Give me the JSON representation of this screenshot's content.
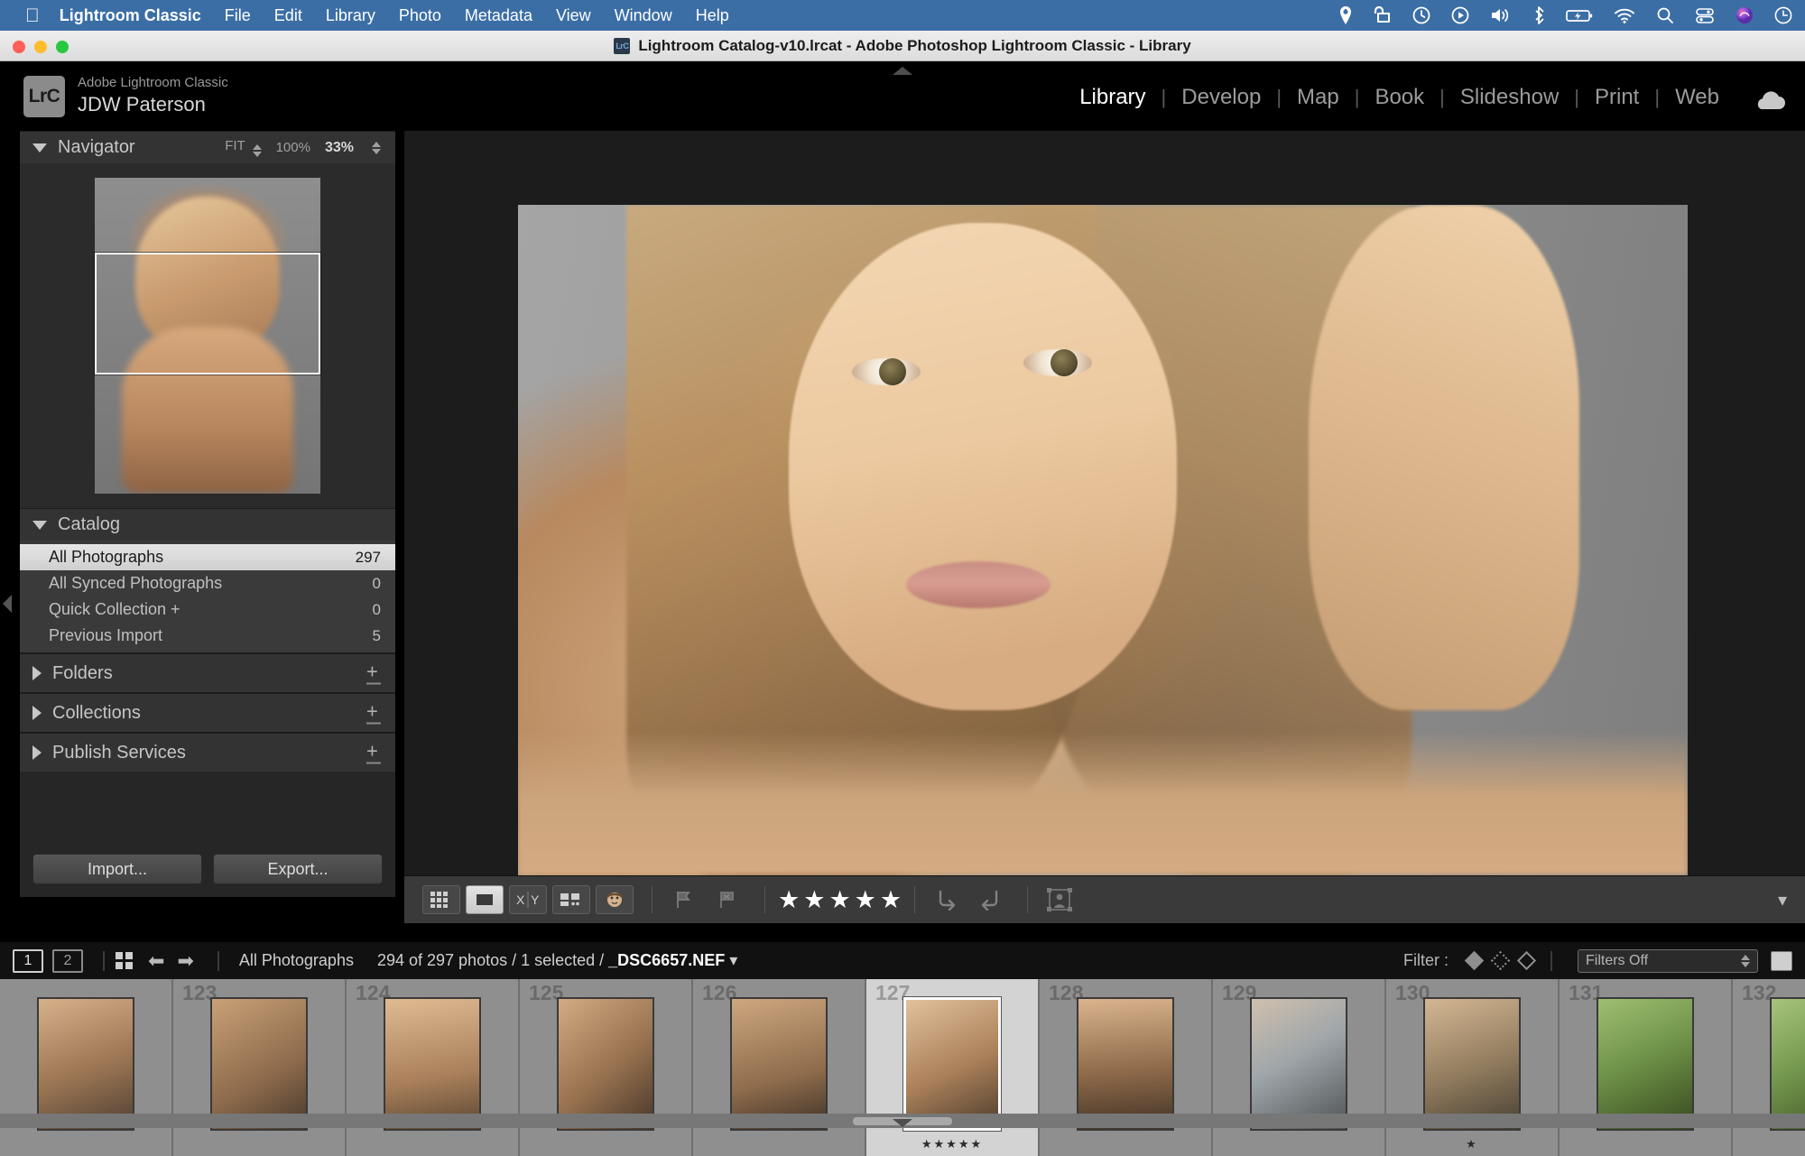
{
  "macbar": {
    "apple_icon": "apple-icon",
    "menus": [
      {
        "label": "Lightroom Classic",
        "bold": true
      },
      {
        "label": "File",
        "bold": false
      },
      {
        "label": "Edit",
        "bold": false
      },
      {
        "label": "Library",
        "bold": false
      },
      {
        "label": "Photo",
        "bold": false
      },
      {
        "label": "Metadata",
        "bold": false
      },
      {
        "label": "View",
        "bold": false
      },
      {
        "label": "Window",
        "bold": false
      },
      {
        "label": "Help",
        "bold": false
      }
    ],
    "status_icons": [
      "location-icon",
      "screen-lock-icon",
      "time-machine-icon",
      "play-icon",
      "volume-icon",
      "bluetooth-icon",
      "battery-charging-icon",
      "wifi-icon",
      "spotlight-search-icon",
      "control-center-icon",
      "siri-icon",
      "clock-icon"
    ],
    "accent_color": "#3b6ea5"
  },
  "window": {
    "title": "Lightroom Catalog-v10.lrcat - Adobe Photoshop Lightroom Classic - Library",
    "app_badge": "LrC",
    "traffic_lights": [
      "close-button",
      "minimize-button",
      "zoom-button"
    ]
  },
  "header": {
    "logo_text": "LrC",
    "identity_small": "Adobe Lightroom Classic",
    "identity_big": "JDW Paterson",
    "modules": [
      {
        "label": "Library",
        "active": true
      },
      {
        "label": "Develop",
        "active": false
      },
      {
        "label": "Map",
        "active": false
      },
      {
        "label": "Book",
        "active": false
      },
      {
        "label": "Slideshow",
        "active": false
      },
      {
        "label": "Print",
        "active": false
      },
      {
        "label": "Web",
        "active": false
      }
    ],
    "cloud_icon": "cloud-sync-icon"
  },
  "navigator": {
    "title": "Navigator",
    "fit_label": "FIT",
    "hundred_label": "100%",
    "zoom_value": "33%"
  },
  "catalog": {
    "title": "Catalog",
    "items": [
      {
        "label": "All Photographs",
        "count": "297",
        "selected": true
      },
      {
        "label": "All Synced Photographs",
        "count": "0",
        "selected": false
      },
      {
        "label": "Quick Collection  +",
        "count": "0",
        "selected": false
      },
      {
        "label": "Previous Import",
        "count": "5",
        "selected": false
      }
    ]
  },
  "panels": [
    {
      "label": "Folders"
    },
    {
      "label": "Collections"
    },
    {
      "label": "Publish Services"
    }
  ],
  "buttons": {
    "import": "Import...",
    "export": "Export..."
  },
  "toolbar": {
    "view_icons": [
      {
        "name": "grid-view-icon",
        "active": false
      },
      {
        "name": "loupe-view-icon",
        "active": true
      },
      {
        "name": "compare-view-icon",
        "active": false
      },
      {
        "name": "survey-view-icon",
        "active": false
      },
      {
        "name": "people-view-icon",
        "active": false
      }
    ],
    "flag_icon": "flag-pick-icon",
    "reject_icon": "flag-reject-icon",
    "star_rating": 5,
    "star_glyph": "★",
    "rotate_left_icon": "rotate-left-icon",
    "rotate_right_icon": "rotate-right-icon",
    "crop_overlay_icon": "face-crop-icon",
    "chevron_icon": "chevron-down-icon"
  },
  "filmstrip_bar": {
    "screen1": "1",
    "screen2": "2",
    "grid_icon": "grid-icon",
    "back_icon": "arrow-left-icon",
    "forward_icon": "arrow-right-icon",
    "source": "All Photographs",
    "counts": "294 of 297 photos / 1 selected / ",
    "filename": "_DSC6657.NEF",
    "filename_caret": "▾",
    "filter_label": "Filter :",
    "filter_flags": [
      "flag-pick-diamond",
      "flag-unflagged-diamond",
      "flag-rejected-diamond"
    ],
    "filter_select": "Filters Off",
    "end_button": "filmstrip-toggle-button"
  },
  "filmstrip": {
    "thumbs": [
      {
        "num": "",
        "cls": "p1",
        "selected": false,
        "stars": ""
      },
      {
        "num": "123",
        "cls": "p2",
        "selected": false,
        "stars": ""
      },
      {
        "num": "124",
        "cls": "p3",
        "selected": false,
        "stars": ""
      },
      {
        "num": "125",
        "cls": "p4",
        "selected": false,
        "stars": ""
      },
      {
        "num": "126",
        "cls": "p5",
        "selected": false,
        "stars": ""
      },
      {
        "num": "127",
        "cls": "p6",
        "selected": true,
        "stars": "★★★★★"
      },
      {
        "num": "128",
        "cls": "p7",
        "selected": false,
        "stars": ""
      },
      {
        "num": "129",
        "cls": "p8",
        "selected": false,
        "stars": ""
      },
      {
        "num": "130",
        "cls": "p9",
        "selected": false,
        "stars": "★"
      },
      {
        "num": "131",
        "cls": "p10",
        "selected": false,
        "stars": ""
      },
      {
        "num": "132",
        "cls": "p11",
        "selected": false,
        "stars": ""
      }
    ]
  }
}
